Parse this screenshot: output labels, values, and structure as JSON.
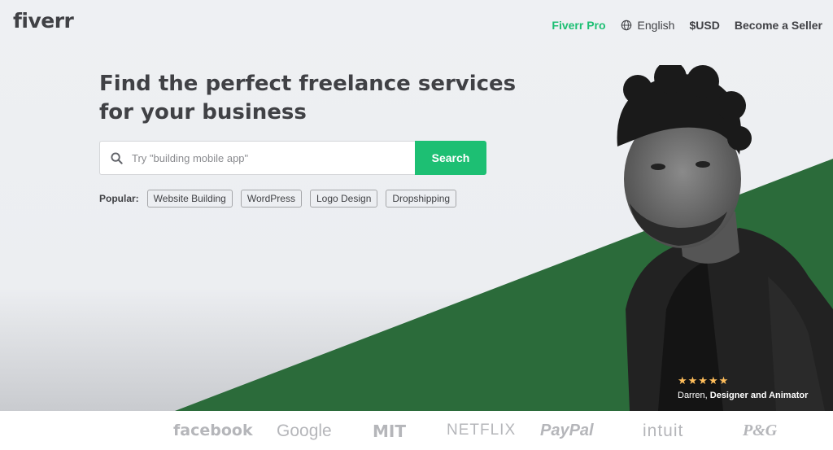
{
  "header": {
    "logo": "fiverr",
    "nav": {
      "pro": "Fiverr Pro",
      "language": "English",
      "currency": "$USD",
      "become_seller": "Become a Seller"
    }
  },
  "hero": {
    "headline": "Find the perfect freelance services for your business",
    "search": {
      "placeholder": "Try \"building mobile app\"",
      "button_label": "Search"
    },
    "popular": {
      "label": "Popular:",
      "tags": [
        "Website Building",
        "WordPress",
        "Logo Design",
        "Dropshipping"
      ]
    },
    "credit": {
      "rating": 5,
      "stars": "★★★★★",
      "name": "Darren,",
      "role": "Designer and Animator"
    }
  },
  "trusted_by": [
    "facebook",
    "Google",
    "MIT",
    "NETFLIX",
    "PayPal",
    "intuit",
    "P&G"
  ],
  "colors": {
    "brand_green": "#1dbf73",
    "dark_green": "#2b6b3a",
    "text_dark": "#404145",
    "logo_gray": "#b5b6ba"
  },
  "icons": {
    "globe": "globe-icon",
    "search": "search-icon",
    "star": "star-icon"
  }
}
